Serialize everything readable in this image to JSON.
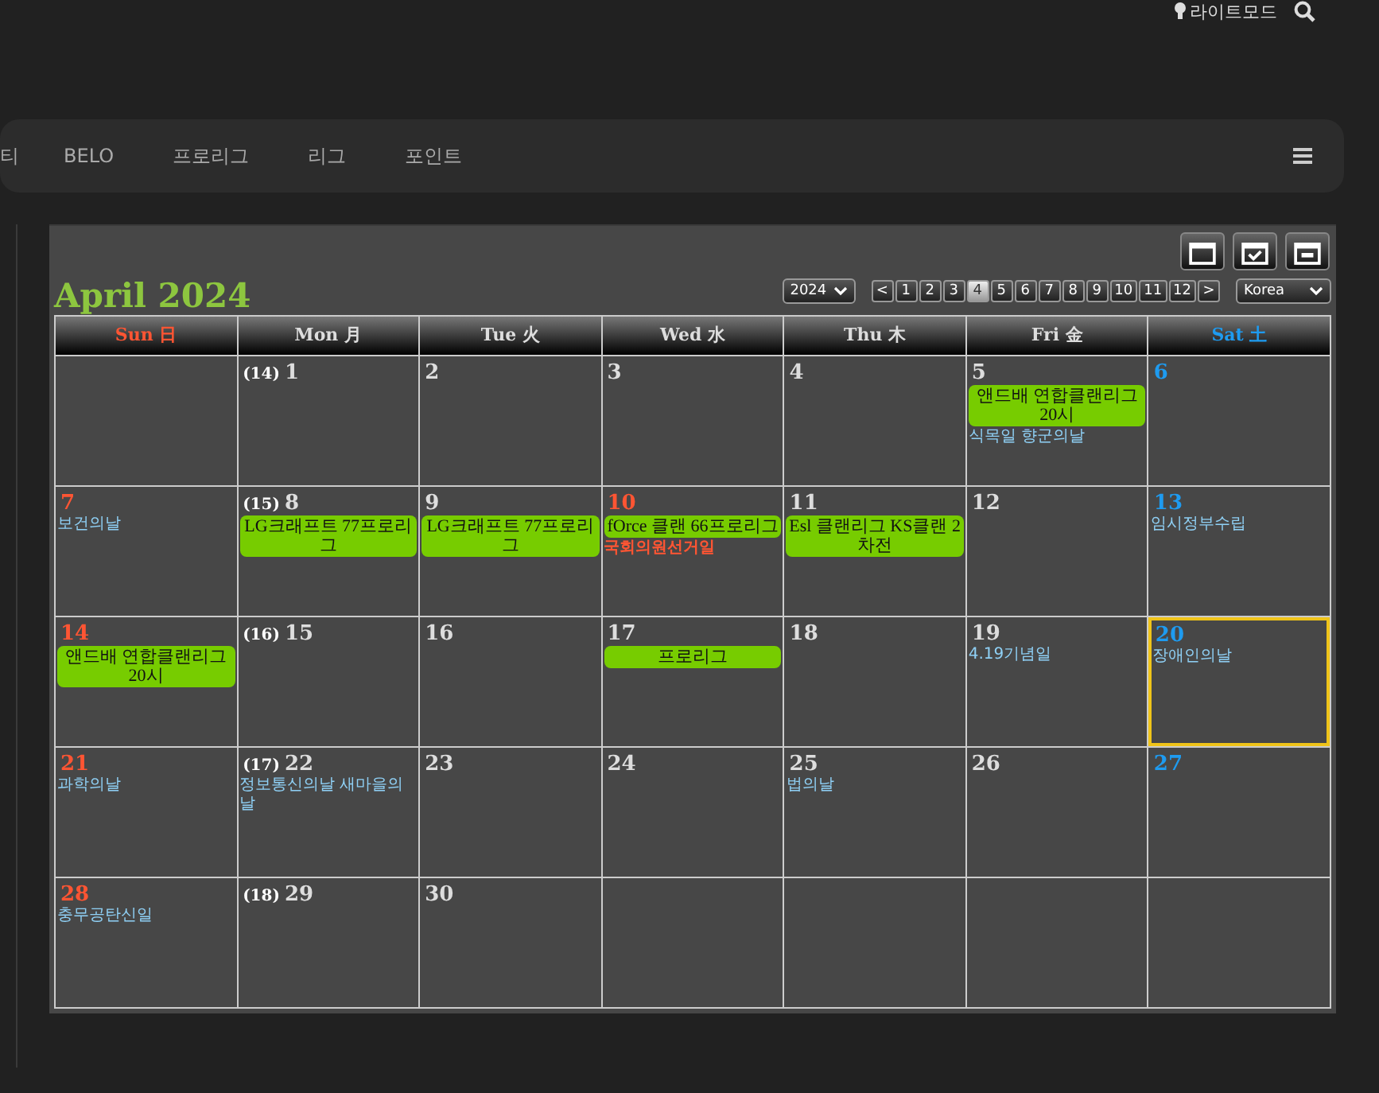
{
  "topbar": {
    "mode_label": "라이트모드"
  },
  "nav": {
    "items": [
      {
        "label": "티"
      },
      {
        "label": "BELO"
      },
      {
        "label": "프로리그"
      },
      {
        "label": "리그"
      },
      {
        "label": "포인트"
      }
    ]
  },
  "calendar": {
    "title": "April 2024",
    "year_select": {
      "value": "2024"
    },
    "prev": {
      "label": "<"
    },
    "next": {
      "label": ">"
    },
    "months": [
      {
        "label": "1",
        "selected": false
      },
      {
        "label": "2",
        "selected": false
      },
      {
        "label": "3",
        "selected": false
      },
      {
        "label": "4",
        "selected": true
      },
      {
        "label": "5",
        "selected": false
      },
      {
        "label": "6",
        "selected": false
      },
      {
        "label": "7",
        "selected": false
      },
      {
        "label": "8",
        "selected": false
      },
      {
        "label": "9",
        "selected": false
      },
      {
        "label": "10",
        "selected": false
      },
      {
        "label": "11",
        "selected": false
      },
      {
        "label": "12",
        "selected": false
      }
    ],
    "region_select": {
      "value": "Korea"
    },
    "headers": [
      {
        "label": "Sun 日",
        "kind": "sun"
      },
      {
        "label": "Mon 月",
        "kind": "weekday"
      },
      {
        "label": "Tue 火",
        "kind": "weekday"
      },
      {
        "label": "Wed 水",
        "kind": "weekday"
      },
      {
        "label": "Thu 木",
        "kind": "weekday"
      },
      {
        "label": "Fri 金",
        "kind": "weekday"
      },
      {
        "label": "Sat 土",
        "kind": "sat"
      }
    ],
    "weeks": [
      [
        {
          "kind": "empty"
        },
        {
          "kind": "weekday",
          "week": "(14)",
          "day": "1",
          "today": false
        },
        {
          "kind": "weekday",
          "day": "2",
          "today": false
        },
        {
          "kind": "weekday",
          "day": "3",
          "today": false
        },
        {
          "kind": "weekday",
          "day": "4",
          "today": false
        },
        {
          "kind": "weekday",
          "day": "5",
          "today": false,
          "events": [
            {
              "kind": "match",
              "text": "앤드배 연합클랜리그 20시"
            },
            {
              "kind": "memorial",
              "text": "식목일 향군의날"
            }
          ]
        },
        {
          "kind": "sat",
          "day": "6",
          "today": false
        }
      ],
      [
        {
          "kind": "sun",
          "day": "7",
          "today": false,
          "events": [
            {
              "kind": "memorial",
              "text": "보건의날"
            }
          ]
        },
        {
          "kind": "weekday",
          "week": "(15)",
          "day": "8",
          "today": false,
          "events": [
            {
              "kind": "match",
              "text": "LG크래프트 77프로리그"
            }
          ]
        },
        {
          "kind": "weekday",
          "day": "9",
          "today": false,
          "events": [
            {
              "kind": "match",
              "text": "LG크래프트 77프로리그"
            }
          ]
        },
        {
          "kind": "holiday",
          "day": "10",
          "today": false,
          "events": [
            {
              "kind": "match",
              "text": "fOrce 클랜 66프로리그"
            },
            {
              "kind": "holiday",
              "text": "국회의원선거일"
            }
          ]
        },
        {
          "kind": "weekday",
          "day": "11",
          "today": false,
          "events": [
            {
              "kind": "match",
              "text": "Esl 클랜리그 KS클랜 2차전"
            }
          ]
        },
        {
          "kind": "weekday",
          "day": "12",
          "today": false
        },
        {
          "kind": "sat",
          "day": "13",
          "today": false,
          "events": [
            {
              "kind": "memorial",
              "text": "임시정부수립"
            }
          ]
        }
      ],
      [
        {
          "kind": "sun",
          "day": "14",
          "today": false,
          "events": [
            {
              "kind": "match",
              "text": "앤드배 연합클랜리그 20시"
            }
          ]
        },
        {
          "kind": "weekday",
          "week": "(16)",
          "day": "15",
          "today": false
        },
        {
          "kind": "weekday",
          "day": "16",
          "today": false
        },
        {
          "kind": "weekday",
          "day": "17",
          "today": false,
          "events": [
            {
              "kind": "match",
              "text": "프로리그"
            }
          ]
        },
        {
          "kind": "weekday",
          "day": "18",
          "today": false
        },
        {
          "kind": "weekday",
          "day": "19",
          "today": false,
          "events": [
            {
              "kind": "memorial",
              "text": "4.19기념일"
            }
          ]
        },
        {
          "kind": "sat",
          "day": "20",
          "today": true,
          "events": [
            {
              "kind": "memorial",
              "text": "장애인의날"
            }
          ]
        }
      ],
      [
        {
          "kind": "sun",
          "day": "21",
          "today": false,
          "events": [
            {
              "kind": "memorial",
              "text": "과학의날"
            }
          ]
        },
        {
          "kind": "weekday",
          "week": "(17)",
          "day": "22",
          "today": false,
          "events": [
            {
              "kind": "memorial",
              "text": "정보통신의날 새마을의날"
            }
          ]
        },
        {
          "kind": "weekday",
          "day": "23",
          "today": false
        },
        {
          "kind": "weekday",
          "day": "24",
          "today": false
        },
        {
          "kind": "weekday",
          "day": "25",
          "today": false,
          "events": [
            {
              "kind": "memorial",
              "text": "법의날"
            }
          ]
        },
        {
          "kind": "weekday",
          "day": "26",
          "today": false
        },
        {
          "kind": "sat",
          "day": "27",
          "today": false
        }
      ],
      [
        {
          "kind": "sun",
          "day": "28",
          "today": false,
          "events": [
            {
              "kind": "memorial",
              "text": "충무공탄신일"
            }
          ]
        },
        {
          "kind": "weekday",
          "week": "(18)",
          "day": "29",
          "today": false
        },
        {
          "kind": "weekday",
          "day": "30",
          "today": false
        },
        {
          "kind": "empty"
        },
        {
          "kind": "empty"
        },
        {
          "kind": "empty"
        },
        {
          "kind": "empty"
        }
      ]
    ]
  }
}
